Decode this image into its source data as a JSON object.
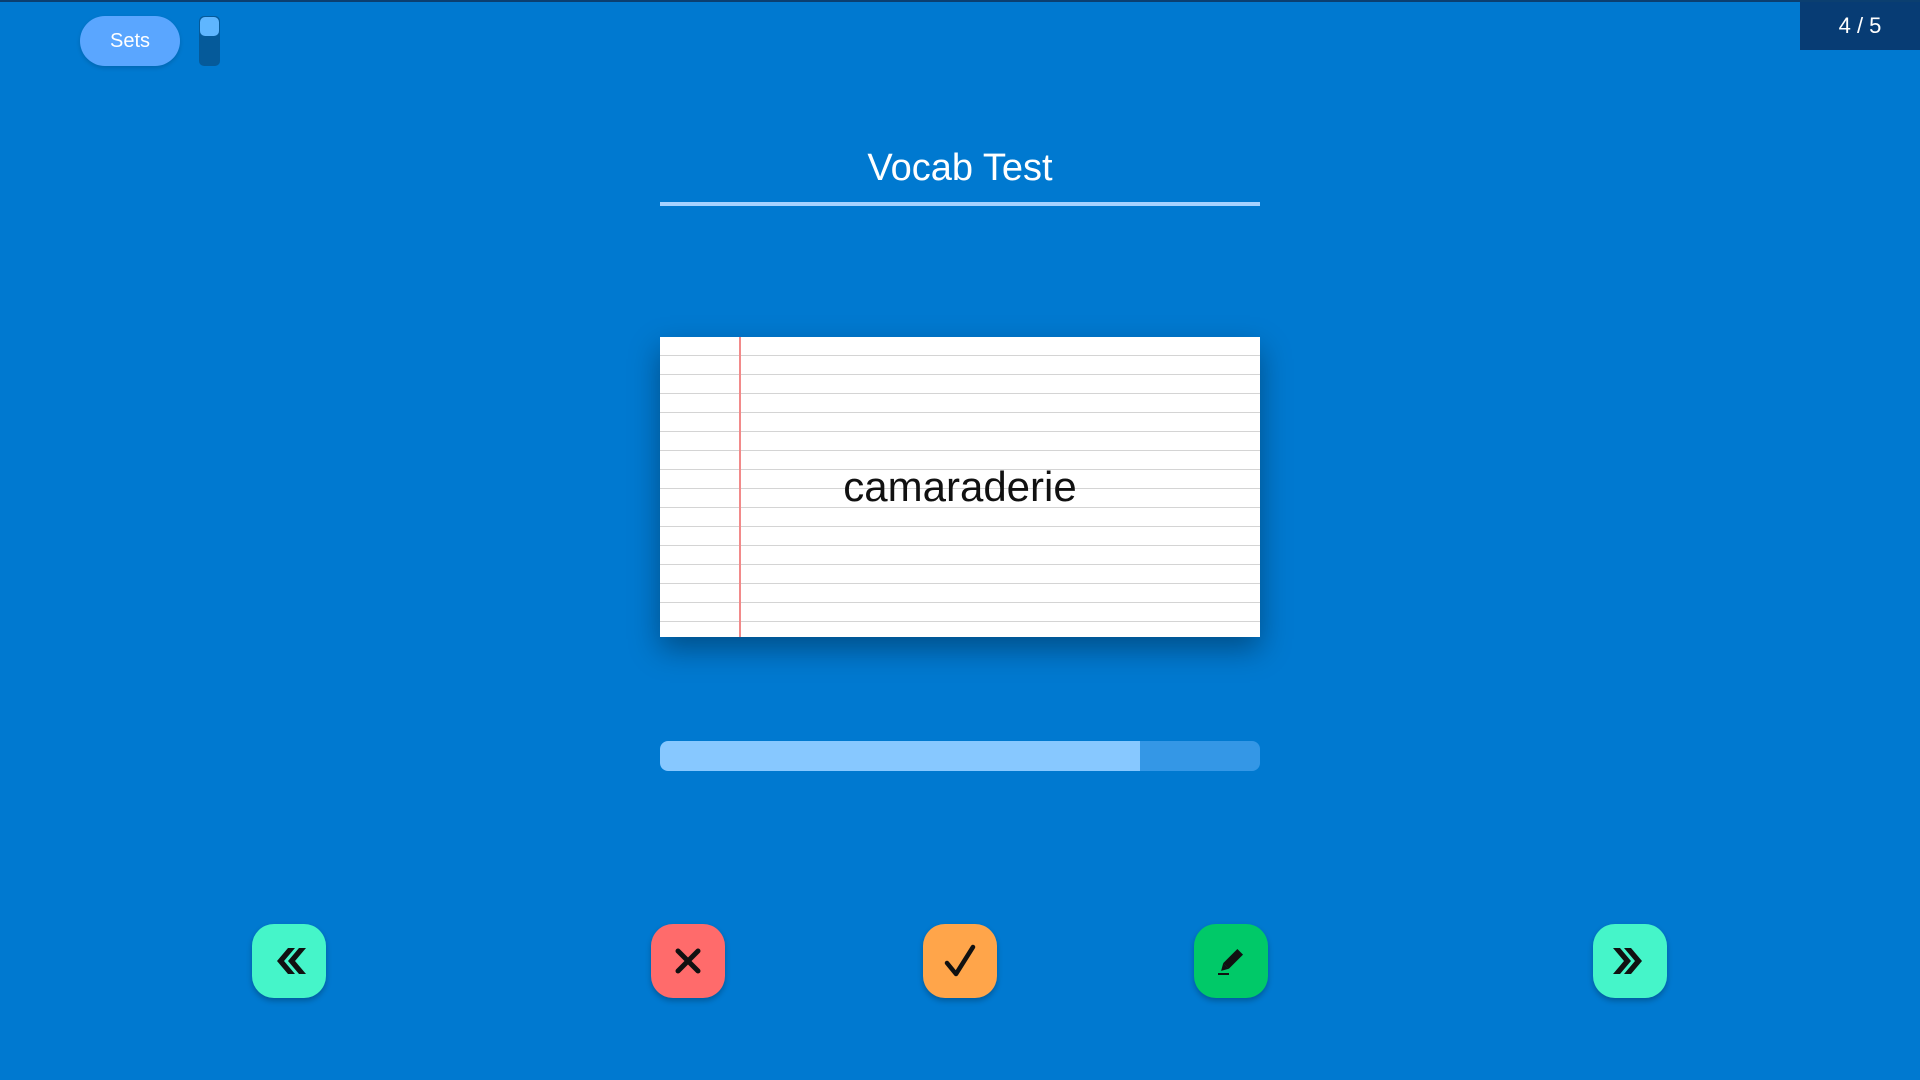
{
  "header": {
    "sets_label": "Sets",
    "counter": "4 / 5"
  },
  "set": {
    "title": "Vocab Test"
  },
  "card": {
    "word": "camaraderie"
  },
  "progress": {
    "current": 4,
    "total": 5,
    "fraction": 0.8
  },
  "controls": {
    "previous": {
      "icon": "double-chevron-left-icon"
    },
    "wrong": {
      "icon": "x-icon"
    },
    "right": {
      "icon": "check-icon"
    },
    "edit": {
      "icon": "pencil-icon"
    },
    "next": {
      "icon": "double-chevron-right-icon"
    }
  },
  "colors": {
    "background": "#0079D0",
    "nav": "#45F5C9",
    "wrong": "#FF6B6B",
    "right": "#FFA54A",
    "edit": "#00C968",
    "progress_fill": "#87C8FF"
  }
}
